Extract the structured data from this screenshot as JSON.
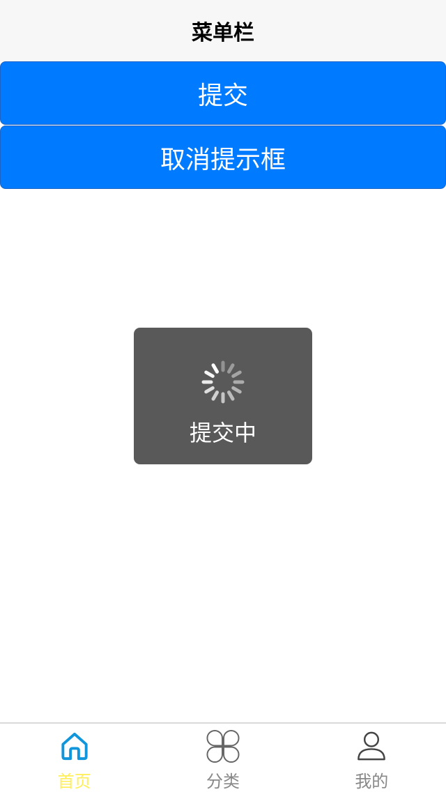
{
  "nav": {
    "title": "菜单栏"
  },
  "buttons": {
    "submit": "提交",
    "cancel": "取消提示框"
  },
  "toast": {
    "text": "提交中",
    "icon": "loading-spinner-icon"
  },
  "tabs": [
    {
      "label": "首页",
      "icon": "home-icon",
      "active": true
    },
    {
      "label": "分类",
      "icon": "category-icon",
      "active": false
    },
    {
      "label": "我的",
      "icon": "user-icon",
      "active": false
    }
  ],
  "colors": {
    "primary": "#007aff",
    "nav_bg": "#f7f7f7",
    "toast_bg": "#595959",
    "tab_active_icon": "#1296db",
    "tab_active_label": "#ffee58",
    "tab_inactive": "#888888"
  }
}
